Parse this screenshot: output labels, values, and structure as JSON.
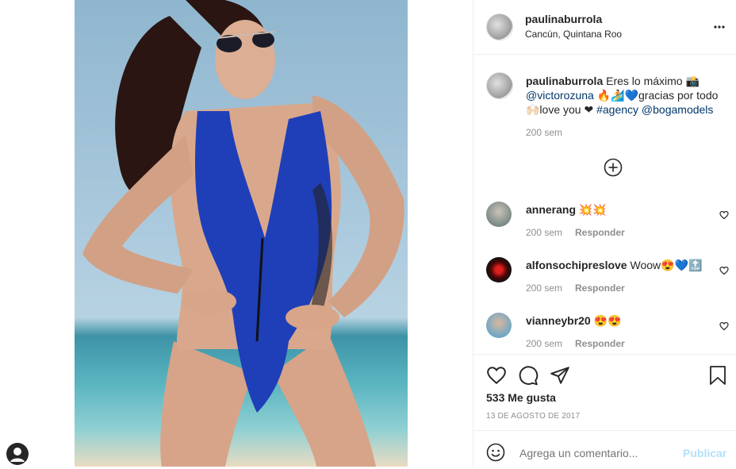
{
  "post": {
    "username": "paulinaburrola",
    "location": "Cancún, Quintana Roo",
    "more_icon": "more-horizontal-icon"
  },
  "caption": {
    "username": "paulinaburrola",
    "line1_text": "Eres lo máximo 📸",
    "line2_mention": "@victorozuna",
    "line2_text": " 🔥🏄💙gracias por todo",
    "line3_text": "🙌🏻love you ❤ ",
    "line3_hashtag": "#agency",
    "line3_mention": " @bogamodels",
    "time": "200 sem"
  },
  "load_more_icon": "plus-circle-icon",
  "comments": [
    {
      "username": "annerang",
      "text": " 💥💥",
      "time": "200 sem",
      "reply": "Responder"
    },
    {
      "username": "alfonsochipreslove",
      "text": " Woow😍💙🔝",
      "time": "200 sem",
      "reply": "Responder"
    },
    {
      "username": "vianneybr20",
      "text": " 😍😍",
      "time": "200 sem",
      "reply": "Responder"
    }
  ],
  "actions": {
    "likes": "533 Me gusta",
    "date": "13 DE AGOSTO DE 2017"
  },
  "input": {
    "placeholder": "Agrega un comentario...",
    "publish": "Publicar"
  },
  "colors": {
    "swimsuit": "#1f3fb8",
    "publish_disabled": "#b2dffc",
    "link": "#00376b"
  }
}
